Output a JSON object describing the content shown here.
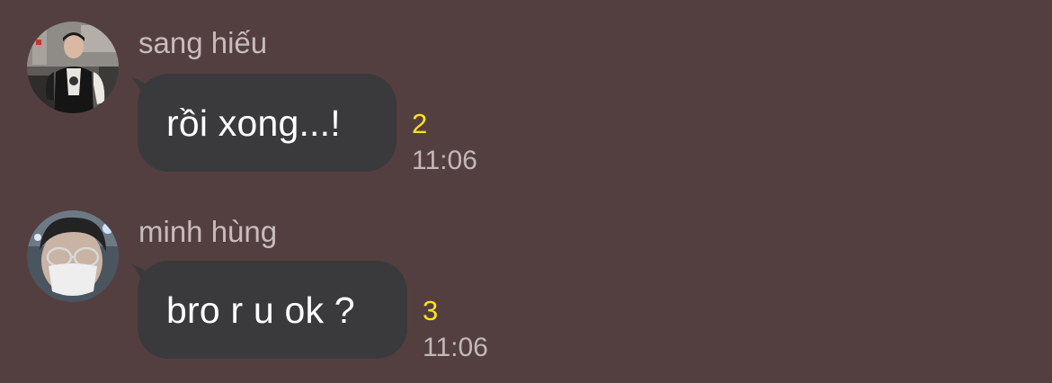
{
  "messages": [
    {
      "sender": "sang hiếu",
      "text": "rồi xong...!",
      "unread_count": "2",
      "time": "11:06"
    },
    {
      "sender": "minh hùng",
      "text": "bro r u ok ?",
      "unread_count": "3",
      "time": "11:06"
    }
  ],
  "colors": {
    "background": "#543f40",
    "bubble": "#3a3a3c",
    "unread": "#ffe024",
    "meta_text": "#c2b8b8"
  },
  "icons": {
    "avatar_1": "avatar-photo",
    "avatar_2": "avatar-photo"
  }
}
